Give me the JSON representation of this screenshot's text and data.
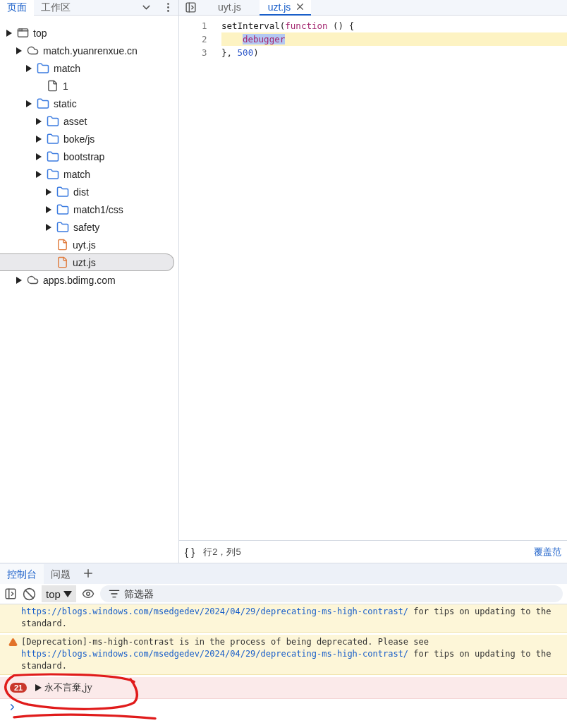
{
  "sidebar": {
    "tabs": [
      {
        "label": "页面",
        "selected": true
      },
      {
        "label": "工作区",
        "selected": false
      }
    ],
    "tree": [
      {
        "kind": "frame",
        "label": "top",
        "expandable": true,
        "selected": false,
        "children": [
          {
            "kind": "domain",
            "label": "match.yuanrenxue.cn",
            "expandable": true,
            "selected": false,
            "children": [
              {
                "kind": "folder",
                "label": "match",
                "expandable": true,
                "selected": false,
                "children": [
                  {
                    "kind": "file",
                    "label": "1",
                    "expandable": false,
                    "selected": false
                  }
                ]
              },
              {
                "kind": "folder",
                "label": "static",
                "expandable": true,
                "selected": false,
                "children": [
                  {
                    "kind": "folder",
                    "label": "asset",
                    "expandable": true,
                    "selected": false
                  },
                  {
                    "kind": "folder",
                    "label": "boke/js",
                    "expandable": true,
                    "selected": false
                  },
                  {
                    "kind": "folder",
                    "label": "bootstrap",
                    "expandable": true,
                    "selected": false
                  },
                  {
                    "kind": "folder",
                    "label": "match",
                    "expandable": true,
                    "selected": false,
                    "children": [
                      {
                        "kind": "folder",
                        "label": "dist",
                        "expandable": true,
                        "selected": false
                      },
                      {
                        "kind": "folder",
                        "label": "match1/css",
                        "expandable": true,
                        "selected": false
                      },
                      {
                        "kind": "folder",
                        "label": "safety",
                        "expandable": true,
                        "selected": false
                      },
                      {
                        "kind": "script",
                        "label": "uyt.js",
                        "expandable": false,
                        "selected": false
                      },
                      {
                        "kind": "script",
                        "label": "uzt.js",
                        "expandable": false,
                        "selected": true
                      }
                    ]
                  }
                ]
              }
            ]
          },
          {
            "kind": "domain",
            "label": "apps.bdimg.com",
            "expandable": true,
            "selected": false
          }
        ]
      }
    ]
  },
  "editor": {
    "tabs": [
      {
        "label": "uyt.js",
        "selected": false
      },
      {
        "label": "uzt.js",
        "selected": true
      }
    ],
    "lines": [
      {
        "number": "1",
        "highlighted": false,
        "indented": false,
        "tokens": [
          {
            "kind": "plain",
            "text": "setInterval(",
            "selected": false
          },
          {
            "kind": "keyword",
            "text": "function",
            "selected": false
          },
          {
            "kind": "plain",
            "text": " () {",
            "selected": false
          }
        ]
      },
      {
        "number": "2",
        "highlighted": true,
        "indented": true,
        "tokens": [
          {
            "kind": "keyword",
            "text": "debugger",
            "selected": true
          }
        ]
      },
      {
        "number": "3",
        "highlighted": false,
        "indented": false,
        "tokens": [
          {
            "kind": "plain",
            "text": "}, ",
            "selected": false
          },
          {
            "kind": "number",
            "text": "500",
            "selected": false
          },
          {
            "kind": "plain",
            "text": ")",
            "selected": false
          }
        ]
      }
    ],
    "status_bar": {
      "format_button": "{ }",
      "position": "行2，列5",
      "coverage_link": "覆盖范"
    }
  },
  "console": {
    "tabs": [
      {
        "label": "控制台",
        "selected": true
      },
      {
        "label": "问题",
        "selected": false
      }
    ],
    "context": "top",
    "filter": {
      "placeholder": "筛选器"
    },
    "messages": [
      {
        "kind": "warning",
        "show_icon": false,
        "link": "https://blogs.windows.com/msedgedev/2024/04/29/deprecating-ms-high-contrast/",
        "after": " for tips on updating to the standard."
      },
      {
        "kind": "warning",
        "show_icon": true,
        "text": "[Deprecation]-ms-high-contrast is in the process of being deprecated. Please see ",
        "link": "https://blogs.windows.com/msedgedev/2024/04/29/deprecating-ms-high-contrast/",
        "after": " for tips on updating to the standard."
      },
      {
        "kind": "error",
        "count": "21",
        "text": "永不言棄,jy"
      }
    ]
  }
}
